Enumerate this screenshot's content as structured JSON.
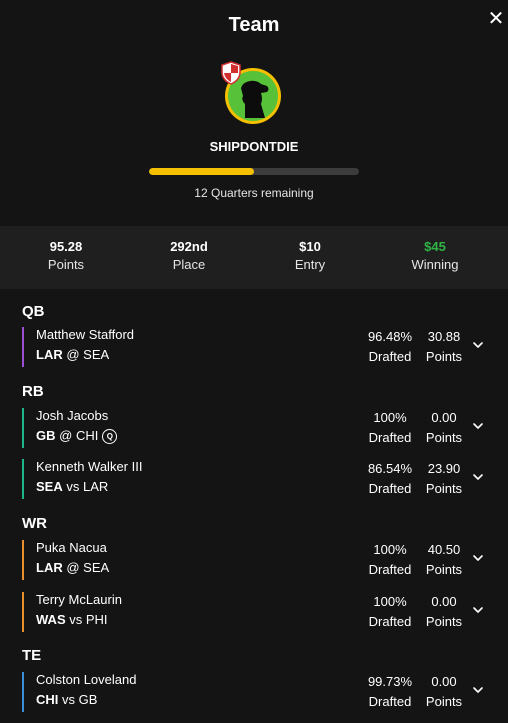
{
  "header": {
    "title": "Team",
    "close_icon": "close-icon",
    "team_name": "SHIPDONTDIE",
    "progress_fraction": 0.5,
    "progress_color": "#f5c000",
    "remaining_text": "12 Quarters remaining"
  },
  "stats": [
    {
      "value": "95.28",
      "label": "Points"
    },
    {
      "value": "292nd",
      "label": "Place"
    },
    {
      "value": "$10",
      "label": "Entry"
    },
    {
      "value": "$45",
      "label": "Winning",
      "color": "#2fb344"
    }
  ],
  "roster": {
    "sections": [
      {
        "position": "QB",
        "players": [
          {
            "name": "Matthew Stafford",
            "team": "LAR",
            "sep": "@",
            "opp": "SEA",
            "drafted": "96.48%",
            "drafted_label": "Drafted",
            "points": "30.88",
            "points_label": "Points",
            "color": "#9b4fd1"
          }
        ]
      },
      {
        "position": "RB",
        "players": [
          {
            "name": "Josh Jacobs",
            "team": "GB",
            "sep": "@",
            "opp": "CHI",
            "badge": "Q",
            "drafted": "100%",
            "drafted_label": "Drafted",
            "points": "0.00",
            "points_label": "Points",
            "color": "#1fb58a"
          },
          {
            "name": "Kenneth Walker III",
            "team": "SEA",
            "sep": "vs",
            "opp": "LAR",
            "drafted": "86.54%",
            "drafted_label": "Drafted",
            "points": "23.90",
            "points_label": "Points",
            "color": "#1fb58a"
          }
        ]
      },
      {
        "position": "WR",
        "players": [
          {
            "name": "Puka Nacua",
            "team": "LAR",
            "sep": "@",
            "opp": "SEA",
            "drafted": "100%",
            "drafted_label": "Drafted",
            "points": "40.50",
            "points_label": "Points",
            "color": "#e8902e"
          },
          {
            "name": "Terry McLaurin",
            "team": "WAS",
            "sep": "vs",
            "opp": "PHI",
            "drafted": "100%",
            "drafted_label": "Drafted",
            "points": "0.00",
            "points_label": "Points",
            "color": "#e8902e"
          }
        ]
      },
      {
        "position": "TE",
        "players": [
          {
            "name": "Colston Loveland",
            "team": "CHI",
            "sep": "vs",
            "opp": "GB",
            "drafted": "99.73%",
            "drafted_label": "Drafted",
            "points": "0.00",
            "points_label": "Points",
            "color": "#3a8fd6"
          }
        ]
      }
    ]
  }
}
